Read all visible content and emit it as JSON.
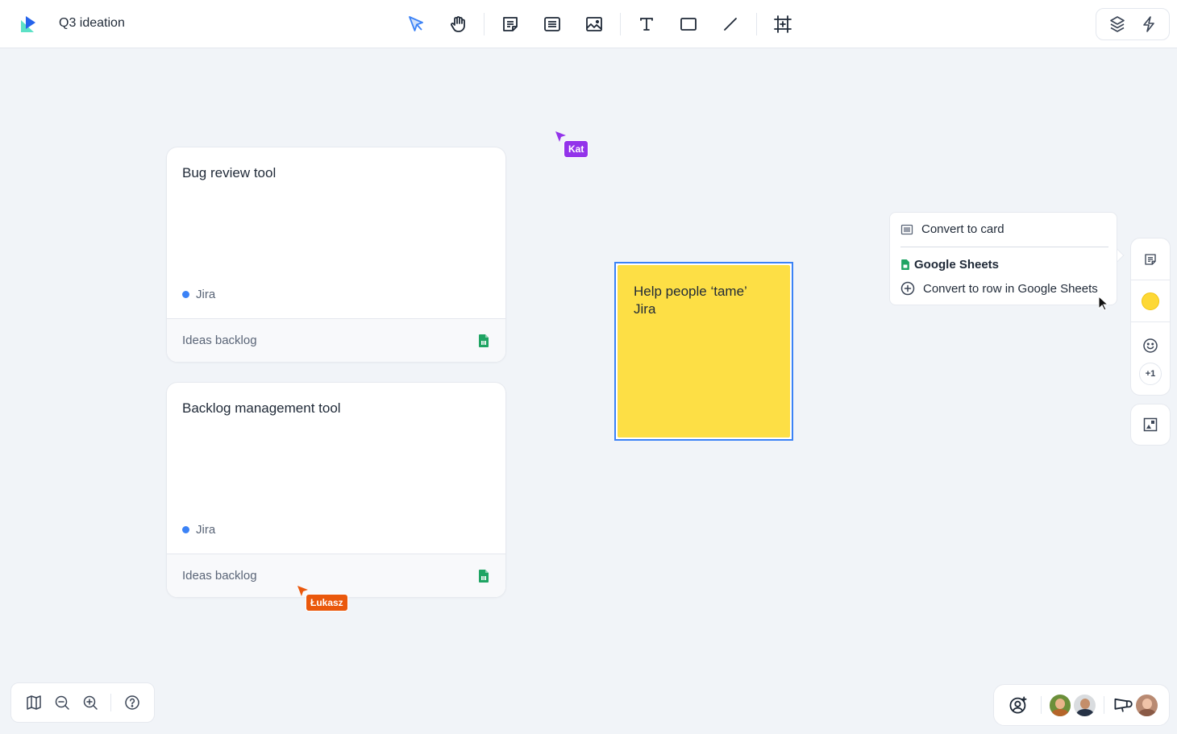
{
  "header": {
    "board_title": "Q3 ideation",
    "logo": "app-logo",
    "tools": [
      {
        "name": "select-tool",
        "icon": "pointer-arrow-icon",
        "active": true
      },
      {
        "name": "hand-tool",
        "icon": "hand-icon",
        "active": false
      },
      {
        "name": "sticky-note-tool",
        "icon": "sticky-note-icon",
        "active": false
      },
      {
        "name": "card-tool",
        "icon": "card-icon",
        "active": false
      },
      {
        "name": "image-tool",
        "icon": "image-icon",
        "active": false
      },
      {
        "name": "text-tool",
        "icon": "text-icon",
        "active": false
      },
      {
        "name": "rectangle-tool",
        "icon": "rectangle-icon",
        "active": false
      },
      {
        "name": "line-tool",
        "icon": "line-icon",
        "active": false
      },
      {
        "name": "frame-tool",
        "icon": "frame-icon",
        "active": false
      }
    ],
    "right_actions": [
      {
        "name": "layers-button",
        "icon": "layers-icon"
      },
      {
        "name": "automation-button",
        "icon": "lightning-icon"
      }
    ]
  },
  "cards": [
    {
      "title": "Bug review tool",
      "tag": "Jira",
      "tag_color": "#3b82f6",
      "footer": "Ideas backlog",
      "footer_icon": "google-sheets-icon"
    },
    {
      "title": "Backlog management tool",
      "tag": "Jira",
      "tag_color": "#3b82f6",
      "footer": "Ideas backlog",
      "footer_icon": "google-sheets-icon"
    }
  ],
  "sticky_note": {
    "text": "Help people ‘tame’ Jira",
    "color": "#fddf45",
    "selected": true
  },
  "collaborator_cursors": [
    {
      "name": "Kat",
      "color": "#9333ea"
    },
    {
      "name": "Łukasz",
      "color": "#ea580c"
    }
  ],
  "context_menu": {
    "convert_to_card": "Convert to card",
    "section_heading": "Google Sheets",
    "convert_to_row": "Convert to row in Google Sheets"
  },
  "side_panel": {
    "note_type_icon": "sticky-note-icon",
    "color_value": "#fdd835",
    "reaction_icon": "smiley-icon",
    "reaction_count": "+1",
    "image_icon": "image-placeholder-icon"
  },
  "bottom_left": {
    "tools": [
      "map-icon",
      "zoom-out-icon",
      "zoom-in-icon",
      "help-icon"
    ]
  },
  "bottom_right": {
    "invite_icon": "add-user-icon",
    "participants": [
      "avatar-1",
      "avatar-2"
    ],
    "announce_icon": "megaphone-icon",
    "current_user": "avatar-3"
  },
  "colors": {
    "accent": "#3b82f6",
    "canvas": "#f1f4f8",
    "sheets_green": "#1fa463"
  }
}
